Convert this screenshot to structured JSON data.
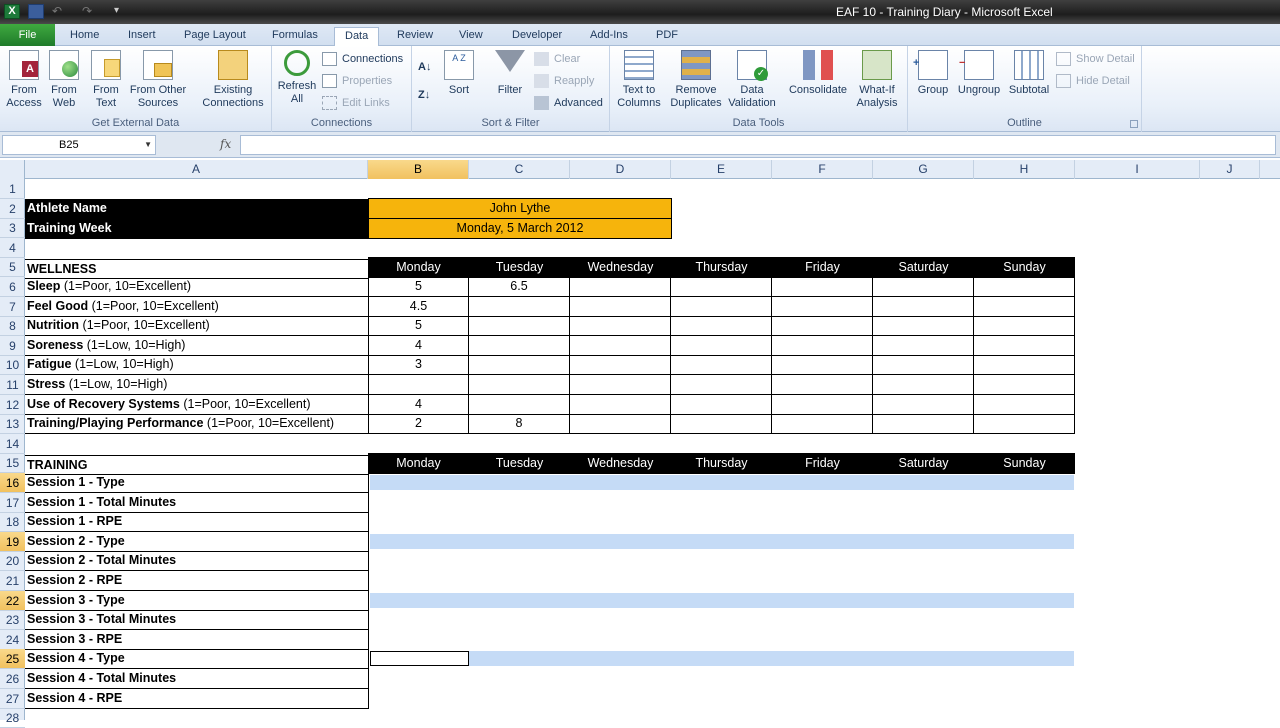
{
  "window": {
    "title": "EAF 10 - Training Diary  -  Microsoft Excel"
  },
  "tabs": [
    "File",
    "Home",
    "Insert",
    "Page Layout",
    "Formulas",
    "Data",
    "Review",
    "View",
    "Developer",
    "Add-Ins",
    "PDF"
  ],
  "active_tab": "Data",
  "ribbon": {
    "get_external": {
      "label": "Get External Data",
      "from_access": "From Access",
      "from_web": "From Web",
      "from_text": "From Text",
      "from_other": "From Other Sources",
      "existing": "Existing Connections"
    },
    "connections": {
      "label": "Connections",
      "refresh": "Refresh All",
      "connections": "Connections",
      "properties": "Properties",
      "edit_links": "Edit Links"
    },
    "sort_filter": {
      "label": "Sort & Filter",
      "sort": "Sort",
      "filter": "Filter",
      "clear": "Clear",
      "reapply": "Reapply",
      "advanced": "Advanced"
    },
    "data_tools": {
      "label": "Data Tools",
      "text_to_columns": "Text to Columns",
      "remove_duplicates": "Remove Duplicates",
      "data_validation": "Data Validation",
      "consolidate": "Consolidate",
      "what_if": "What-If Analysis"
    },
    "outline": {
      "label": "Outline",
      "group": "Group",
      "ungroup": "Ungroup",
      "subtotal": "Subtotal",
      "show_detail": "Show Detail",
      "hide_detail": "Hide Detail"
    }
  },
  "formula_bar": {
    "name_box": "B25",
    "fx": "fx",
    "formula": ""
  },
  "columns": [
    "A",
    "B",
    "C",
    "D",
    "E",
    "F",
    "G",
    "H",
    "I",
    "J"
  ],
  "selected_column": "B",
  "selected_rows": [
    "16",
    "19",
    "22",
    "25"
  ],
  "rows": [
    "1",
    "2",
    "3",
    "4",
    "5",
    "6",
    "7",
    "8",
    "9",
    "10",
    "11",
    "12",
    "13",
    "14",
    "15",
    "16",
    "17",
    "18",
    "19",
    "20",
    "21",
    "22",
    "23",
    "24",
    "25",
    "26",
    "27",
    "28"
  ],
  "sheet": {
    "athlete_label": "Athlete Name",
    "athlete_value": "John Lythe",
    "week_label": "Training Week",
    "week_value": "Monday, 5 March 2012",
    "wellness_title": "WELLNESS",
    "training_title": "TRAINING",
    "days": [
      "Monday",
      "Tuesday",
      "Wednesday",
      "Thursday",
      "Friday",
      "Saturday",
      "Sunday"
    ],
    "wellness": [
      {
        "name": "Sleep",
        "scale": " (1=Poor, 10=Excellent)",
        "values": [
          "5",
          "6.5",
          "",
          "",
          "",
          "",
          ""
        ]
      },
      {
        "name": "Feel Good",
        "scale": " (1=Poor, 10=Excellent)",
        "values": [
          "4.5",
          "",
          "",
          "",
          "",
          "",
          ""
        ]
      },
      {
        "name": "Nutrition",
        "scale": " (1=Poor, 10=Excellent)",
        "values": [
          "5",
          "",
          "",
          "",
          "",
          "",
          ""
        ]
      },
      {
        "name": "Soreness",
        "scale": " (1=Low, 10=High)",
        "values": [
          "4",
          "",
          "",
          "",
          "",
          "",
          ""
        ]
      },
      {
        "name": "Fatigue",
        "scale": "  (1=Low, 10=High)",
        "values": [
          "3",
          "",
          "",
          "",
          "",
          "",
          ""
        ]
      },
      {
        "name": "Stress",
        "scale": "  (1=Low, 10=High)",
        "values": [
          "",
          "",
          "",
          "",
          "",
          "",
          ""
        ]
      },
      {
        "name": "Use of Recovery Systems",
        "scale": " (1=Poor, 10=Excellent)",
        "values": [
          "4",
          "",
          "",
          "",
          "",
          "",
          ""
        ]
      },
      {
        "name": "Training/Playing Performance",
        "scale": " (1=Poor, 10=Excellent)",
        "values": [
          "2",
          "8",
          "",
          "",
          "",
          "",
          ""
        ]
      }
    ],
    "training": [
      "Session 1 - Type",
      "Session 1 - Total Minutes",
      "Session 1 - RPE",
      "Session 2 - Type",
      "Session 2 - Total Minutes",
      "Session 2 - RPE",
      "Session 3 - Type",
      "Session 3 - Total Minutes",
      "Session 3 - RPE",
      "Session 4 - Type",
      "Session 4 - Total Minutes",
      "Session 4 - RPE"
    ]
  }
}
